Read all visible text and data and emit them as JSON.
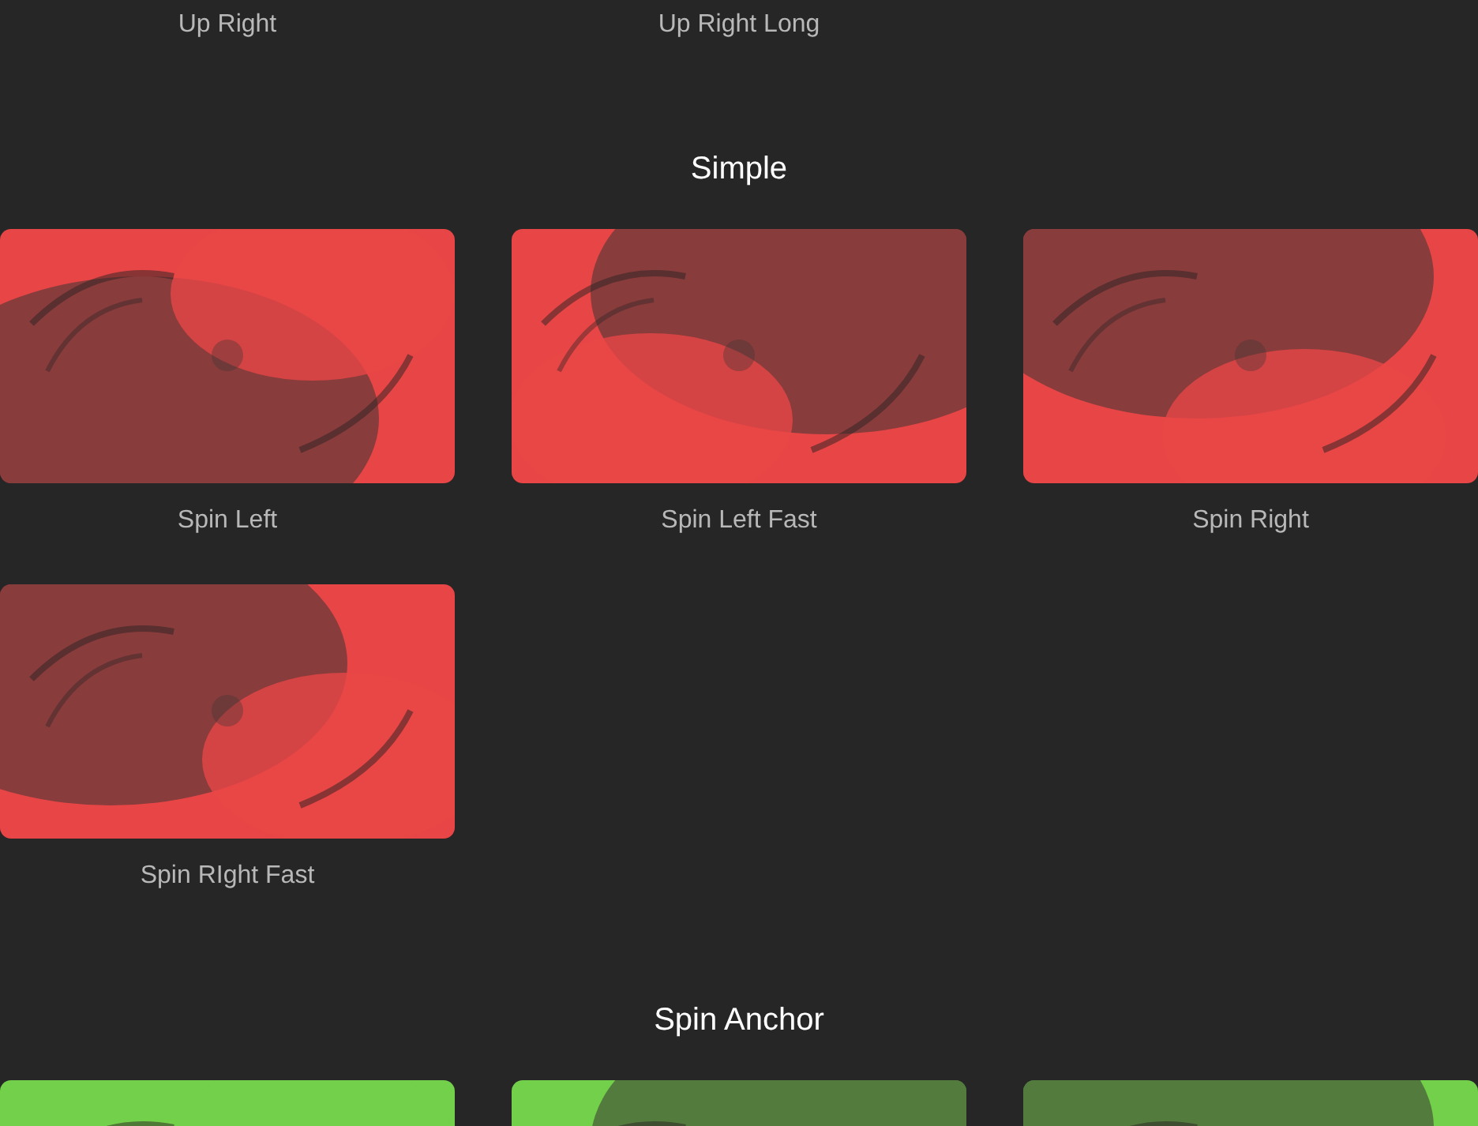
{
  "top_labels": [
    "Up Right",
    "Up Right Long"
  ],
  "sections": [
    {
      "heading": "Simple",
      "items": [
        {
          "label": "Spin Left"
        },
        {
          "label": "Spin Left Fast"
        },
        {
          "label": "Spin Right"
        },
        {
          "label": "Spin RIght Fast"
        }
      ]
    },
    {
      "heading": "Spin Anchor"
    }
  ]
}
